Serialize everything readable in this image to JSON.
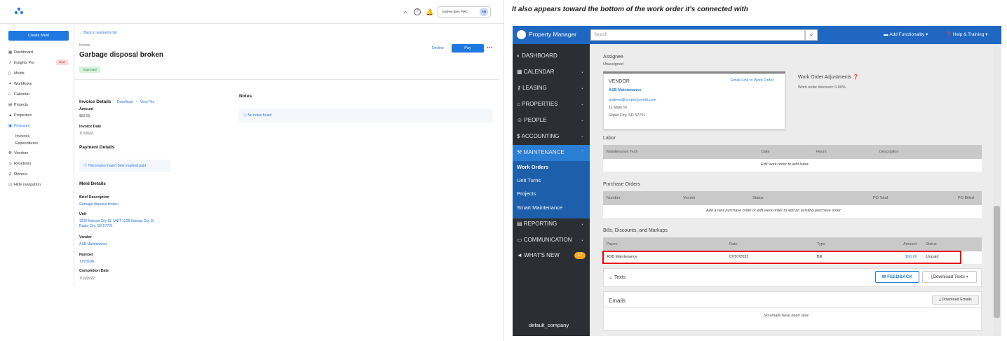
{
  "left_app": {
    "topbar": {
      "user_name": "Andrew Bien PMC",
      "user_initials": "AB"
    },
    "sidebar": {
      "create_label": "Create Meld",
      "items": [
        {
          "label": "Dashboard",
          "icon": "grid-icon"
        },
        {
          "label": "Insights Pro",
          "icon": "insights-icon",
          "badge": "New"
        },
        {
          "label": "Melds",
          "icon": "doc-icon"
        },
        {
          "label": "Workflows",
          "icon": "workflow-icon"
        },
        {
          "label": "Calendar",
          "icon": "calendar-icon"
        },
        {
          "label": "Projects",
          "icon": "projects-icon"
        },
        {
          "label": "Properties",
          "icon": "building-icon"
        },
        {
          "label": "Finances",
          "icon": "finances-icon"
        },
        {
          "label": "Invoices"
        },
        {
          "label": "Expenditures"
        },
        {
          "label": "Vendors",
          "icon": "wrench-icon"
        },
        {
          "label": "Residents",
          "icon": "residents-icon"
        },
        {
          "label": "Owners",
          "icon": "key-icon"
        },
        {
          "label": "Hide navigation",
          "icon": "hide-icon"
        }
      ]
    },
    "invoice": {
      "back": "Back to payments list",
      "kind": "Invoice",
      "title": "Garbage disposal broken",
      "status": "Approved",
      "decline": "Decline",
      "pay": "Pay",
      "details_title": "Invoice Details",
      "download": "Download",
      "view_file": "View File",
      "amount_label": "Amount",
      "amount": "$90.00",
      "date_label": "Invoice Date",
      "date": "7/7/2022",
      "payment_title": "Payment Details",
      "not_paid": "This invoice hasn't been marked paid",
      "meld_title": "Meld Details",
      "brief_label": "Brief Description",
      "brief": "Garbage disposal broken",
      "unit_label": "Unit",
      "unit_line1": "1228 Kansas City St, UNIT 1228 Kansas City St",
      "unit_line2": "Rapid City, SD 57701",
      "vendor_label": "Vendor",
      "vendor": "ASB Maintenance",
      "number_label": "Number",
      "number": "TJYHDAI",
      "completion_label": "Completion Date",
      "completion": "7/11/2022",
      "notes_title": "Notes",
      "no_notes": "No notes found"
    }
  },
  "right_caption": "It also appears toward the bottom of the work order it's connected with",
  "pm": {
    "brand": "Property Manager",
    "search_placeholder": "Search",
    "add_functionality": "Add Functionality",
    "help": "Help & Training",
    "nav": [
      "DASHBOARD",
      "CALENDAR",
      "LEASING",
      "PROPERTIES",
      "PEOPLE",
      "ACCOUNTING",
      "MAINTENANCE",
      "REPORTING",
      "COMMUNICATION",
      "WHAT'S NEW"
    ],
    "maintenance_sub": [
      "Work Orders",
      "Unit Turns",
      "Projects",
      "Smart Maintenance"
    ],
    "whats_new_badge": "17",
    "company": "default_company",
    "assignee_label": "Assignee",
    "assignee": "Unassigned",
    "vendor_heading": "VENDOR",
    "email_link": "Email Link to Work Order",
    "vendor_name": "ASB Maintenance",
    "vendor_email": "andrew@propertymeld.com",
    "vendor_addr1": "11 Main St",
    "vendor_addr2": "Rapid City, SD 57701",
    "adjustments_title": "Work Order Adjustments",
    "discount": "Work order discount: 0.00%",
    "labor_title": "Labor",
    "labor_cols": [
      "Maintenance Tech",
      "Date",
      "Hours",
      "Description"
    ],
    "labor_empty": "Edit work order to add labor.",
    "po_title": "Purchase Orders",
    "po_cols": [
      "Number",
      "Vendor",
      "Status",
      "PO Total",
      "PO Billed"
    ],
    "po_empty": "Add a new purchase order or edit work order to add an existing purchase order.",
    "bills_title": "Bills, Discounts, and Markups",
    "bills_cols": [
      "Payee",
      "Date",
      "Type",
      "Amount",
      "Status"
    ],
    "bill_row": {
      "payee": "ASB Maintenance",
      "date": "07/07/2022",
      "type": "Bill",
      "amount": "$90.00",
      "status": "Unpaid"
    },
    "texts_title": "Texts",
    "feedback": "FEEDBACK",
    "download_texts": "Download Texts",
    "emails_title": "Emails",
    "download_emails": "Download Emails",
    "emails_empty": "No emails have been sent."
  },
  "colors": {
    "primary": "#1f78e0",
    "pm_blue": "#2067c1",
    "pm_sidebar": "#2b2f33",
    "highlight": "#ee0000",
    "approved_bg": "#d7f3de"
  }
}
